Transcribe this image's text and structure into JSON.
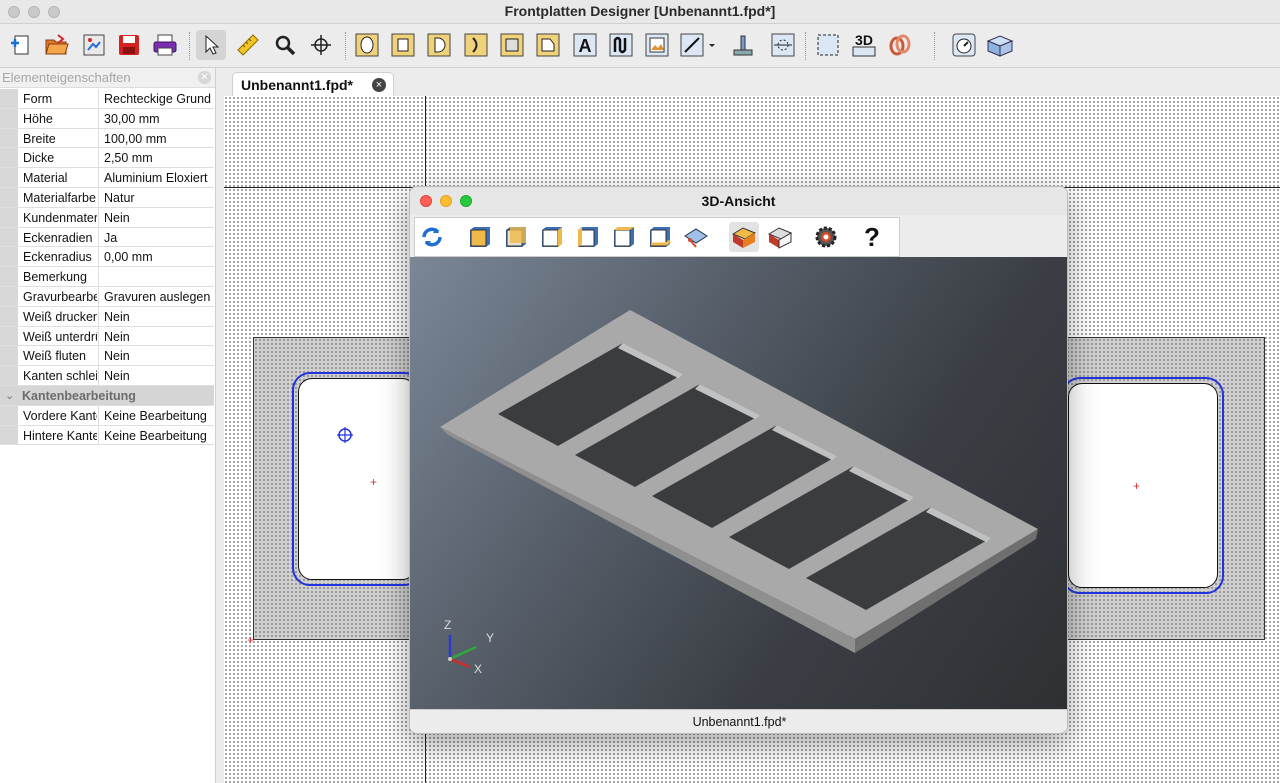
{
  "app": {
    "title": "Frontplatten Designer [Unbenannt1.fpd*]"
  },
  "toolbar": {
    "icons": [
      "new-icon",
      "open-icon",
      "import-icon",
      "save-icon",
      "print-icon",
      "pointer-icon",
      "ruler-icon",
      "zoom-icon",
      "crosshair-icon",
      "round-hole-icon",
      "rect-hole-icon",
      "d-hole-icon",
      "double-d-hole-icon",
      "square-pocket-icon",
      "polygon-icon",
      "text-icon",
      "engraving-curve-icon",
      "image-icon",
      "line-icon",
      "threaded-bolt-icon",
      "dimension-icon",
      "frame-icon",
      "3d-view-icon",
      "link-icon",
      "speedometer-icon",
      "box-view-icon"
    ],
    "text_a": "A",
    "text_3d": "3D"
  },
  "properties_panel": {
    "header": "Elementeigenschaften",
    "rows": [
      {
        "key": "Form",
        "value": "Rechteckige Grund"
      },
      {
        "key": "Höhe",
        "value": "30,00 mm"
      },
      {
        "key": "Breite",
        "value": "100,00 mm"
      },
      {
        "key": "Dicke",
        "value": "2,50 mm"
      },
      {
        "key": "Material",
        "value": "Aluminium Eloxiert"
      },
      {
        "key": "Materialfarbe",
        "value": "Natur"
      },
      {
        "key": "Kundenmaterial",
        "value": "Nein"
      },
      {
        "key": "Eckenradien",
        "value": "Ja"
      },
      {
        "key": "Eckenradius",
        "value": "0,00 mm"
      },
      {
        "key": "Bemerkung",
        "value": ""
      },
      {
        "key": "Gravurbearbeitung",
        "value": "Gravuren auslegen"
      },
      {
        "key": "Weiß drucken",
        "value": "Nein"
      },
      {
        "key": "Weiß unterdrücken",
        "value": "Nein"
      },
      {
        "key": "Weiß fluten",
        "value": "Nein"
      },
      {
        "key": "Kanten schleifen",
        "value": "Nein"
      }
    ],
    "group": {
      "label": "Kantenbearbeitung"
    },
    "group_rows": [
      {
        "key": "Vordere Kante",
        "value": "Keine Bearbeitung"
      },
      {
        "key": "Hintere Kante",
        "value": "Keine Bearbeitung"
      }
    ]
  },
  "tabs": [
    {
      "label": "Unbenannt1.fpd*",
      "close": "×"
    }
  ],
  "dialog": {
    "title": "3D-Ansicht",
    "tools": [
      "refresh-view-icon",
      "view-front-icon",
      "view-back-icon",
      "view-left-icon",
      "view-right-icon",
      "view-top-icon",
      "view-bottom-icon",
      "view-iso-icon",
      "render-mode-1-icon",
      "render-mode-2-icon",
      "settings-gear-icon",
      "help-icon"
    ],
    "help_glyph": "?",
    "axes": {
      "x": "X",
      "y": "Y",
      "z": "Z"
    },
    "status": "Unbenannt1.fpd*"
  },
  "colors": {
    "accent_blue": "#2233dd",
    "marker_red": "#e03030",
    "plate_gray": "#d0d0d0"
  }
}
